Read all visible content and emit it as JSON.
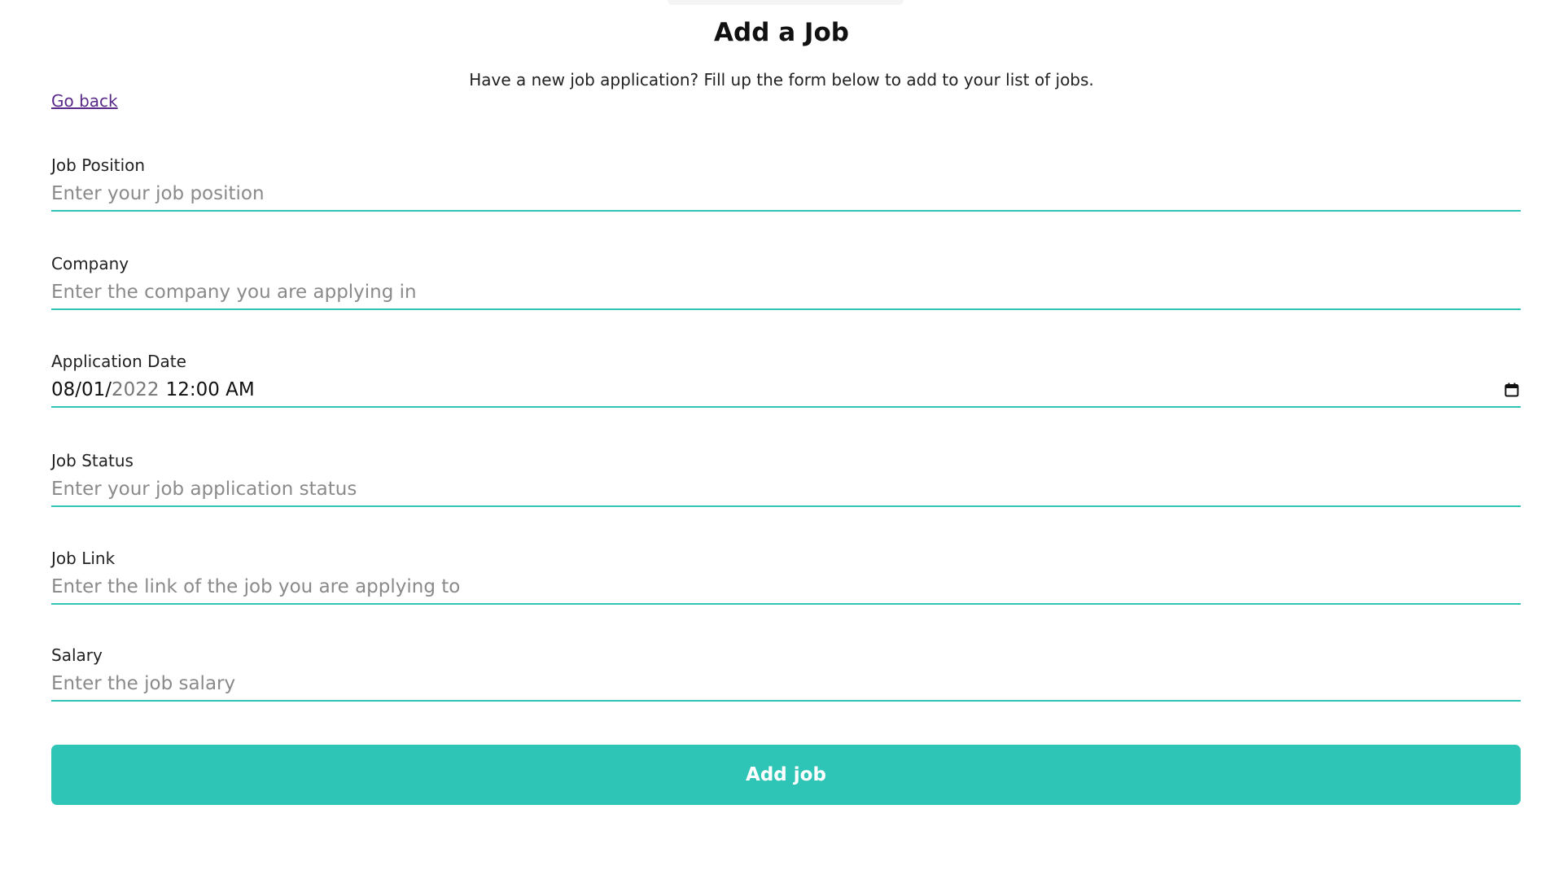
{
  "header": {
    "title": "Add a Job",
    "subtitle": "Have a new job application? Fill up the form below to add to your list of jobs.",
    "go_back": "Go back"
  },
  "form": {
    "job_position": {
      "label": "Job Position",
      "placeholder": "Enter your job position",
      "value": ""
    },
    "company": {
      "label": "Company",
      "placeholder": "Enter the company you are applying in",
      "value": ""
    },
    "application_date": {
      "label": "Application Date",
      "month_day": "08/01/",
      "year": "2022",
      "time": "12:00 AM",
      "icon": "calendar-icon"
    },
    "job_status": {
      "label": "Job Status",
      "placeholder": "Enter your job application status",
      "value": ""
    },
    "job_link": {
      "label": "Job Link",
      "placeholder": "Enter the link of the job you are applying to",
      "value": ""
    },
    "salary": {
      "label": "Salary",
      "placeholder": "Enter the job salary",
      "value": ""
    },
    "submit_label": "Add job"
  },
  "colors": {
    "accent": "#2ec4b6",
    "link": "#5a2a8a",
    "placeholder": "#8a8a8a"
  }
}
